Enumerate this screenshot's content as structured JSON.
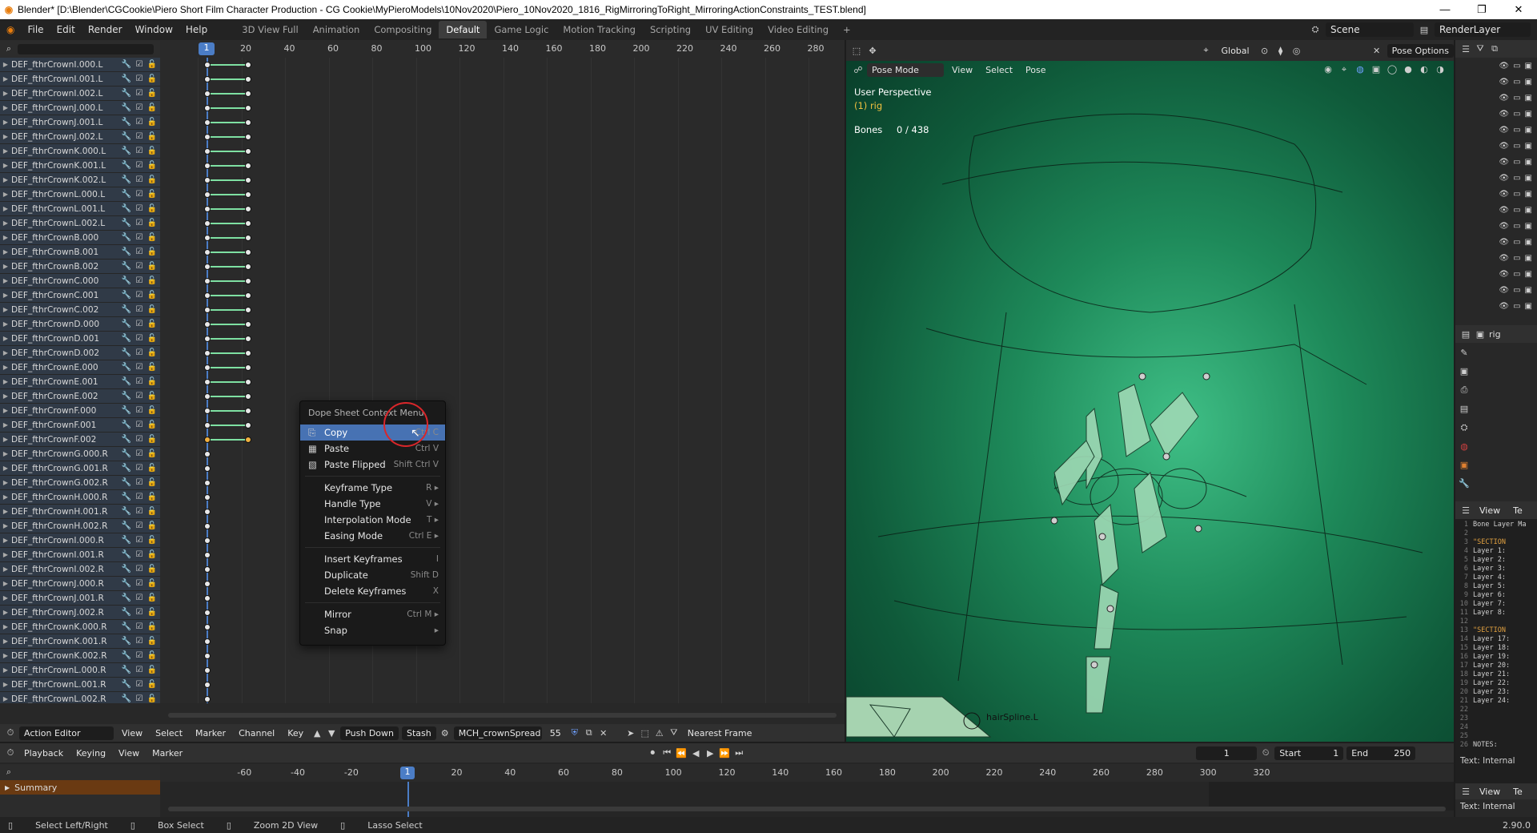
{
  "window": {
    "title": "Blender* [D:\\Blender\\CGCookie\\Piero Short Film Character Production - CG Cookie\\MyPieroModels\\10Nov2020\\Piero_10Nov2020_1816_RigMirroringToRight_MirroringActionConstraints_TEST.blend]",
    "minimize": "—",
    "maximize": "❐",
    "close": "✕"
  },
  "menu": [
    "File",
    "Edit",
    "Render",
    "Window",
    "Help"
  ],
  "workspaces": [
    "3D View Full",
    "Animation",
    "Compositing",
    "Default",
    "Game Logic",
    "Motion Tracking",
    "Scripting",
    "UV Editing",
    "Video Editing"
  ],
  "active_workspace": "Default",
  "add_workspace": "+",
  "scene": {
    "label": "Scene",
    "render_layer": "RenderLayer"
  },
  "dope_ruler": {
    "current_frame": "1",
    "ticks": [
      "20",
      "40",
      "60",
      "80",
      "100",
      "120",
      "140",
      "160",
      "180",
      "200",
      "220",
      "240",
      "260",
      "280"
    ]
  },
  "channels": [
    "DEF_fthrCrownI.000.L",
    "DEF_fthrCrownI.001.L",
    "DEF_fthrCrownI.002.L",
    "DEF_fthrCrownJ.000.L",
    "DEF_fthrCrownJ.001.L",
    "DEF_fthrCrownJ.002.L",
    "DEF_fthrCrownK.000.L",
    "DEF_fthrCrownK.001.L",
    "DEF_fthrCrownK.002.L",
    "DEF_fthrCrownL.000.L",
    "DEF_fthrCrownL.001.L",
    "DEF_fthrCrownL.002.L",
    "DEF_fthrCrownB.000",
    "DEF_fthrCrownB.001",
    "DEF_fthrCrownB.002",
    "DEF_fthrCrownC.000",
    "DEF_fthrCrownC.001",
    "DEF_fthrCrownC.002",
    "DEF_fthrCrownD.000",
    "DEF_fthrCrownD.001",
    "DEF_fthrCrownD.002",
    "DEF_fthrCrownE.000",
    "DEF_fthrCrownE.001",
    "DEF_fthrCrownE.002",
    "DEF_fthrCrownF.000",
    "DEF_fthrCrownF.001",
    "DEF_fthrCrownF.002",
    "DEF_fthrCrownG.000.R",
    "DEF_fthrCrownG.001.R",
    "DEF_fthrCrownG.002.R",
    "DEF_fthrCrownH.000.R",
    "DEF_fthrCrownH.001.R",
    "DEF_fthrCrownH.002.R",
    "DEF_fthrCrownI.000.R",
    "DEF_fthrCrownI.001.R",
    "DEF_fthrCrownI.002.R",
    "DEF_fthrCrownJ.000.R",
    "DEF_fthrCrownJ.001.R",
    "DEF_fthrCrownJ.002.R",
    "DEF_fthrCrownK.000.R",
    "DEF_fthrCrownK.001.R",
    "DEF_fthrCrownK.002.R",
    "DEF_fthrCrownL.000.R",
    "DEF_fthrCrownL.001.R",
    "DEF_fthrCrownL.002.R"
  ],
  "context_menu": {
    "title": "Dope Sheet Context Menu",
    "items": [
      {
        "label": "Copy",
        "shortcut": "Ctrl C",
        "highlighted": true
      },
      {
        "label": "Paste",
        "shortcut": "Ctrl V"
      },
      {
        "label": "Paste Flipped",
        "shortcut": "Shift Ctrl V"
      },
      {
        "label": "Keyframe Type",
        "shortcut": "R ▸"
      },
      {
        "label": "Handle Type",
        "shortcut": "V ▸"
      },
      {
        "label": "Interpolation Mode",
        "shortcut": "T ▸"
      },
      {
        "label": "Easing Mode",
        "shortcut": "Ctrl E ▸"
      },
      {
        "label": "Insert Keyframes",
        "shortcut": "I"
      },
      {
        "label": "Duplicate",
        "shortcut": "Shift D"
      },
      {
        "label": "Delete Keyframes",
        "shortcut": "X"
      },
      {
        "label": "Mirror",
        "shortcut": "Ctrl M ▸"
      },
      {
        "label": "Snap",
        "shortcut": "▸"
      }
    ]
  },
  "dope_header": {
    "mode": "Action Editor",
    "menus": [
      "View",
      "Select",
      "Marker",
      "Channel",
      "Key"
    ],
    "push_down": "Push Down",
    "stash": "Stash",
    "action": "MCH_crownSpread",
    "users": "55",
    "snap": "Nearest Frame"
  },
  "viewport": {
    "mode": "Pose Mode",
    "menus": [
      "View",
      "Select",
      "Pose"
    ],
    "orientation": "Global",
    "pose_options": "Pose Options",
    "perspective": "User Perspective",
    "object": "(1) rig",
    "bones_label": "Bones",
    "bones_value": "0 / 438",
    "bone_label": "hairSpline.L"
  },
  "properties": {
    "object": "rig"
  },
  "text_editor": {
    "view": "View",
    "te": "Te",
    "name": "Text: Internal",
    "lines": [
      {
        "n": "1",
        "t": "Bone Layer Ma"
      },
      {
        "n": "2",
        "t": ""
      },
      {
        "n": "3",
        "t": "\"SECTION"
      },
      {
        "n": "4",
        "t": "Layer 1:"
      },
      {
        "n": "5",
        "t": "Layer 2:"
      },
      {
        "n": "6",
        "t": "Layer 3:"
      },
      {
        "n": "7",
        "t": "Layer 4:"
      },
      {
        "n": "8",
        "t": "Layer 5:"
      },
      {
        "n": "9",
        "t": "Layer 6:"
      },
      {
        "n": "10",
        "t": "Layer 7:"
      },
      {
        "n": "11",
        "t": "Layer 8:"
      },
      {
        "n": "12",
        "t": ""
      },
      {
        "n": "13",
        "t": "\"SECTION"
      },
      {
        "n": "14",
        "t": "Layer 17:"
      },
      {
        "n": "15",
        "t": "Layer 18:"
      },
      {
        "n": "16",
        "t": "Layer 19:"
      },
      {
        "n": "17",
        "t": "Layer 20:"
      },
      {
        "n": "18",
        "t": "Layer 21:"
      },
      {
        "n": "19",
        "t": "Layer 22:"
      },
      {
        "n": "20",
        "t": "Layer 23:"
      },
      {
        "n": "21",
        "t": "Layer 24:"
      },
      {
        "n": "22",
        "t": ""
      },
      {
        "n": "23",
        "t": ""
      },
      {
        "n": "24",
        "t": ""
      },
      {
        "n": "25",
        "t": ""
      },
      {
        "n": "26",
        "t": "NOTES:"
      }
    ]
  },
  "timeline": {
    "menus": [
      "Playback",
      "Keying",
      "View",
      "Marker"
    ],
    "frame": "1",
    "start_label": "Start",
    "start": "1",
    "end_label": "End",
    "end": "250",
    "current_frame": "1",
    "ticks": [
      "-60",
      "-40",
      "-20",
      "20",
      "40",
      "60",
      "80",
      "100",
      "120",
      "140",
      "160",
      "180",
      "200",
      "220",
      "240",
      "260",
      "280",
      "300",
      "320"
    ],
    "summary": "Summary",
    "text_internal": "Text: Internal",
    "version": "2.90.0"
  },
  "status": [
    "Select Left/Right",
    "Box Select",
    "Zoom 2D View",
    "Lasso Select"
  ]
}
